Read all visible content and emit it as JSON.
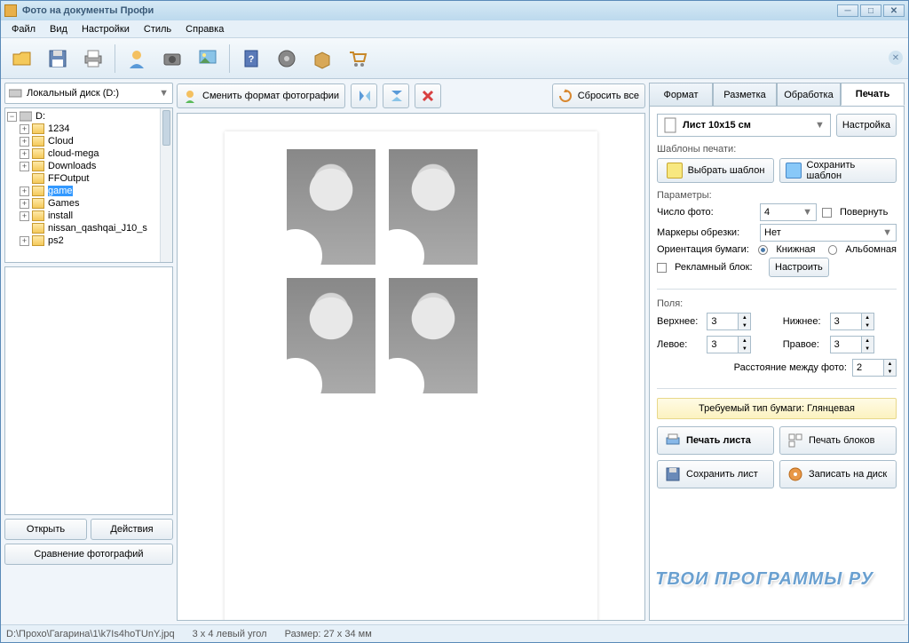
{
  "window": {
    "title": "Фото на документы Профи"
  },
  "menu": [
    "Файл",
    "Вид",
    "Настройки",
    "Стиль",
    "Справка"
  ],
  "toolbar_icons": [
    "open",
    "save",
    "print",
    "person",
    "camera",
    "photo-edit",
    "help",
    "video",
    "box",
    "cart"
  ],
  "drive": {
    "label": "Локальный диск (D:)"
  },
  "tree": {
    "root": "D:",
    "items": [
      {
        "label": "1234",
        "exp": "+"
      },
      {
        "label": "Cloud",
        "exp": "+"
      },
      {
        "label": "cloud-mega",
        "exp": "+"
      },
      {
        "label": "Downloads",
        "exp": "+"
      },
      {
        "label": "FFOutput",
        "exp": ""
      },
      {
        "label": "game",
        "exp": "+",
        "selected": true
      },
      {
        "label": "Games",
        "exp": "+"
      },
      {
        "label": "install",
        "exp": "+"
      },
      {
        "label": "nissan_qashqai_J10_s",
        "exp": ""
      },
      {
        "label": "ps2",
        "exp": "+"
      }
    ]
  },
  "left_buttons": {
    "open": "Открыть",
    "actions": "Действия",
    "compare": "Сравнение фотографий"
  },
  "center_toolbar": {
    "change_format": "Сменить формат фотографии",
    "reset": "Сбросить все"
  },
  "tabs": [
    "Формат",
    "Разметка",
    "Обработка",
    "Печать"
  ],
  "active_tab": 3,
  "print": {
    "sheet_size": "Лист 10x15 см",
    "settings_btn": "Настройка",
    "templates_label": "Шаблоны печати:",
    "choose_template": "Выбрать шаблон",
    "save_template": "Сохранить шаблон",
    "params_label": "Параметры:",
    "count_label": "Число фото:",
    "count_value": "4",
    "rotate_label": "Повернуть",
    "markers_label": "Маркеры обрезки:",
    "markers_value": "Нет",
    "orient_label": "Ориентация бумаги:",
    "orient_portrait": "Книжная",
    "orient_landscape": "Альбомная",
    "ad_label": "Рекламный блок:",
    "ad_btn": "Настроить",
    "margins_label": "Поля:",
    "m_top": "Верхнее:",
    "m_top_v": "3",
    "m_bottom": "Нижнее:",
    "m_bottom_v": "3",
    "m_left": "Левое:",
    "m_left_v": "3",
    "m_right": "Правое:",
    "m_right_v": "3",
    "gap_label": "Расстояние между фото:",
    "gap_v": "2",
    "paper_hint": "Требуемый тип бумаги: Глянцевая",
    "print_sheet": "Печать листа",
    "print_blocks": "Печать блоков",
    "save_sheet": "Сохранить лист",
    "burn_disc": "Записать на диск"
  },
  "statusbar": {
    "path": "D:\\Прохо\\Гагарина\\1\\k7Is4hoTUnY.jpq",
    "corner": "3 x 4 левый угол",
    "size": "Размер: 27 x 34 мм"
  },
  "watermark": "ТВОИ ПРОГРАММЫ РУ"
}
